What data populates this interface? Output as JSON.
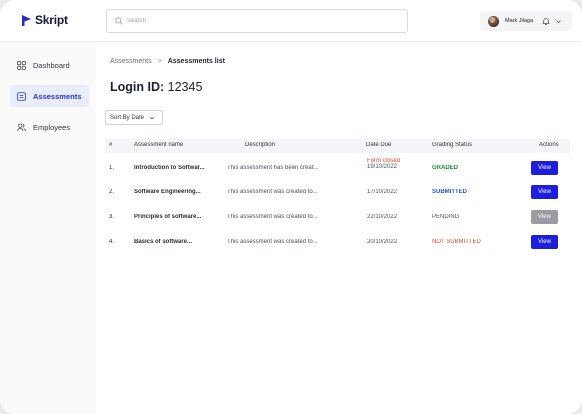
{
  "header": {
    "logo_text": "Skript",
    "search_placeholder": "Search",
    "user_name": "Mark Jilaga"
  },
  "sidebar": {
    "items": [
      {
        "label": "Dashboard",
        "icon": "grid-icon",
        "active": false
      },
      {
        "label": "Assessments",
        "icon": "assessment-icon",
        "active": true
      },
      {
        "label": "Employees",
        "icon": "users-icon",
        "active": false
      }
    ]
  },
  "breadcrumb": {
    "parent": "Assessments",
    "separator": ">",
    "current": "Assessments list"
  },
  "login": {
    "label": "Login ID:",
    "value": "12345"
  },
  "sort": {
    "label": "Sort By Date"
  },
  "table": {
    "headers": {
      "num": "#",
      "name": "Assessment name",
      "description": "Description",
      "date": "Date Due",
      "status": "Grading Status",
      "actions": "Actions"
    },
    "rows": [
      {
        "num": "1.",
        "name": "Introduction to Softwar...",
        "description": "This assessment has been creat...",
        "date_note": "Form closed",
        "date": "19/10/2022",
        "status": "GRADED",
        "action": "View"
      },
      {
        "num": "2.",
        "name": "Software Engineering...",
        "description": "This assessment was created to...",
        "date_note": "",
        "date": "17/10/2022",
        "status": "SUBMITTED",
        "action": "View"
      },
      {
        "num": "3.",
        "name": "Principles of software...",
        "description": "This assessment was created to...",
        "date_note": "",
        "date": "22/10/2022",
        "status": "PENDING",
        "action": "View"
      },
      {
        "num": "4.",
        "name": "Basics of software...",
        "description": "This assessment was created to...",
        "date_note": "",
        "date": "20/10/2022",
        "status": "NOT SUBMITTED",
        "action": "View"
      }
    ]
  },
  "colors": {
    "brand": "#2531c9",
    "view_button": "#1d1ee0",
    "view_button_disabled": "#9a9ca2",
    "graded": "#1c8f2e",
    "submitted": "#2356c9",
    "not_submitted": "#e0452b"
  }
}
